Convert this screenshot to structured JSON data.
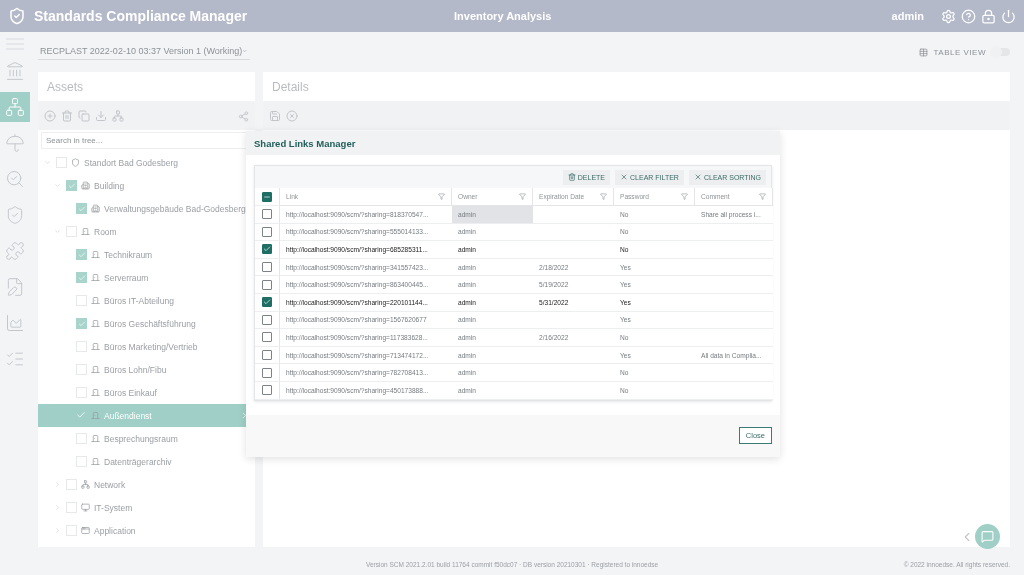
{
  "header": {
    "title": "Standards Compliance Manager",
    "section": "Inventory Analysis",
    "user": "admin"
  },
  "version_select": {
    "value": "RECPLAST 2022-02-10 03:37 Version 1 (Working)"
  },
  "table_view": {
    "label": "TABLE VIEW",
    "on": false
  },
  "rail": [
    {
      "kind": "landmark",
      "selected": false
    },
    {
      "kind": "assets",
      "selected": true
    },
    {
      "kind": "umbrella",
      "selected": false
    },
    {
      "kind": "search",
      "selected": false
    },
    {
      "kind": "shield",
      "selected": false
    },
    {
      "kind": "puzzle",
      "selected": false
    },
    {
      "kind": "document",
      "selected": false
    },
    {
      "kind": "chart",
      "selected": false
    },
    {
      "kind": "list",
      "selected": false
    }
  ],
  "assets": {
    "title": "Assets",
    "search": {
      "placeholder": "Search in tree..."
    },
    "tree": [
      {
        "label": "Standort Bad Godesberg",
        "kind": "site",
        "checked": false,
        "expanded": true,
        "selected": false,
        "children": [
          {
            "label": "Building",
            "kind": "building",
            "checked": true,
            "expanded": true,
            "selected": false,
            "children": [
              {
                "label": "Verwaltungsgebäude Bad-Godesberg",
                "kind": "building",
                "checked": true,
                "selected": false
              }
            ]
          },
          {
            "label": "Room",
            "kind": "room",
            "checked": false,
            "expanded": true,
            "selected": false,
            "children": [
              {
                "label": "Technikraum",
                "kind": "room",
                "checked": true,
                "selected": false
              },
              {
                "label": "Serverraum",
                "kind": "room",
                "checked": true,
                "selected": false
              },
              {
                "label": "Büros IT-Abteilung",
                "kind": "room",
                "checked": false,
                "selected": false
              },
              {
                "label": "Büros Geschäftsführung",
                "kind": "room",
                "checked": true,
                "selected": false
              },
              {
                "label": "Büros Marketing/Vertrieb",
                "kind": "room",
                "checked": false,
                "selected": false
              },
              {
                "label": "Büros Lohn/Fibu",
                "kind": "room",
                "checked": false,
                "selected": false
              },
              {
                "label": "Büros Einkauf",
                "kind": "room",
                "checked": false,
                "selected": false
              },
              {
                "label": "Außendienst",
                "kind": "room",
                "checked": true,
                "selected": true
              },
              {
                "label": "Besprechungsraum",
                "kind": "room",
                "checked": false,
                "selected": false
              },
              {
                "label": "Datenträgerarchiv",
                "kind": "room",
                "checked": false,
                "selected": false
              }
            ]
          },
          {
            "label": "Network",
            "kind": "network",
            "checked": false,
            "expanded": false,
            "selected": false
          },
          {
            "label": "IT-System",
            "kind": "system",
            "checked": false,
            "expanded": false,
            "selected": false
          },
          {
            "label": "Application",
            "kind": "application",
            "checked": false,
            "expanded": false,
            "selected": false
          }
        ]
      }
    ]
  },
  "details": {
    "title": "Details"
  },
  "dialog": {
    "title": "Shared Links Manager",
    "buttons": [
      "DELETE",
      "CLEAR FILTER",
      "CLEAR SORTING"
    ],
    "select_all_indeterminate": true,
    "columns": [
      "Link",
      "Owner",
      "Expiration Date",
      "Password",
      "Comment"
    ],
    "rows": [
      {
        "link": "http://localhost:9090/scm/?sharing=818370547...",
        "owner": "admin",
        "expiration": "",
        "password": "No",
        "comment": "Share all process i...",
        "checked": false,
        "owner_focused": true
      },
      {
        "link": "http://localhost:9090/scm/?sharing=555014133...",
        "owner": "admin",
        "expiration": "",
        "password": "No",
        "comment": "",
        "checked": false,
        "owner_focused": false
      },
      {
        "link": "http://localhost:9090/scm/?sharing=685285311...",
        "owner": "admin",
        "expiration": "",
        "password": "No",
        "comment": "",
        "checked": true,
        "owner_focused": false
      },
      {
        "link": "http://localhost:9090/scm/?sharing=341557423...",
        "owner": "admin",
        "expiration": "2/18/2022",
        "password": "Yes",
        "comment": "",
        "checked": false,
        "owner_focused": false
      },
      {
        "link": "http://localhost:9090/scm/?sharing=863400445...",
        "owner": "admin",
        "expiration": "5/19/2022",
        "password": "Yes",
        "comment": "",
        "checked": false,
        "owner_focused": false
      },
      {
        "link": "http://localhost:9090/scm/?sharing=220101144...",
        "owner": "admin",
        "expiration": "5/31/2022",
        "password": "Yes",
        "comment": "",
        "checked": true,
        "owner_focused": false
      },
      {
        "link": "http://localhost:9090/scm/?sharing=1567620677",
        "owner": "admin",
        "expiration": "",
        "password": "Yes",
        "comment": "",
        "checked": false,
        "owner_focused": false
      },
      {
        "link": "http://localhost:9090/scm/?sharing=117383628...",
        "owner": "admin",
        "expiration": "2/16/2022",
        "password": "No",
        "comment": "",
        "checked": false,
        "owner_focused": false
      },
      {
        "link": "http://localhost:9090/scm/?sharing=713474172...",
        "owner": "admin",
        "expiration": "",
        "password": "Yes",
        "comment": "All data in Complia...",
        "checked": false,
        "owner_focused": false
      },
      {
        "link": "http://localhost:9090/scm/?sharing=782708413...",
        "owner": "admin",
        "expiration": "",
        "password": "No",
        "comment": "",
        "checked": false,
        "owner_focused": false
      },
      {
        "link": "http://localhost:9090/scm/?sharing=450173888...",
        "owner": "admin",
        "expiration": "",
        "password": "No",
        "comment": "",
        "checked": false,
        "owner_focused": false
      }
    ],
    "close": "Close"
  },
  "footer": {
    "version": "Version SCM 2021.2.01 build 11764 commit f50dc07 · DB version 20210301 · Registered to innoedse",
    "copyright": "© 2022 innoedse. All rights reserved."
  }
}
